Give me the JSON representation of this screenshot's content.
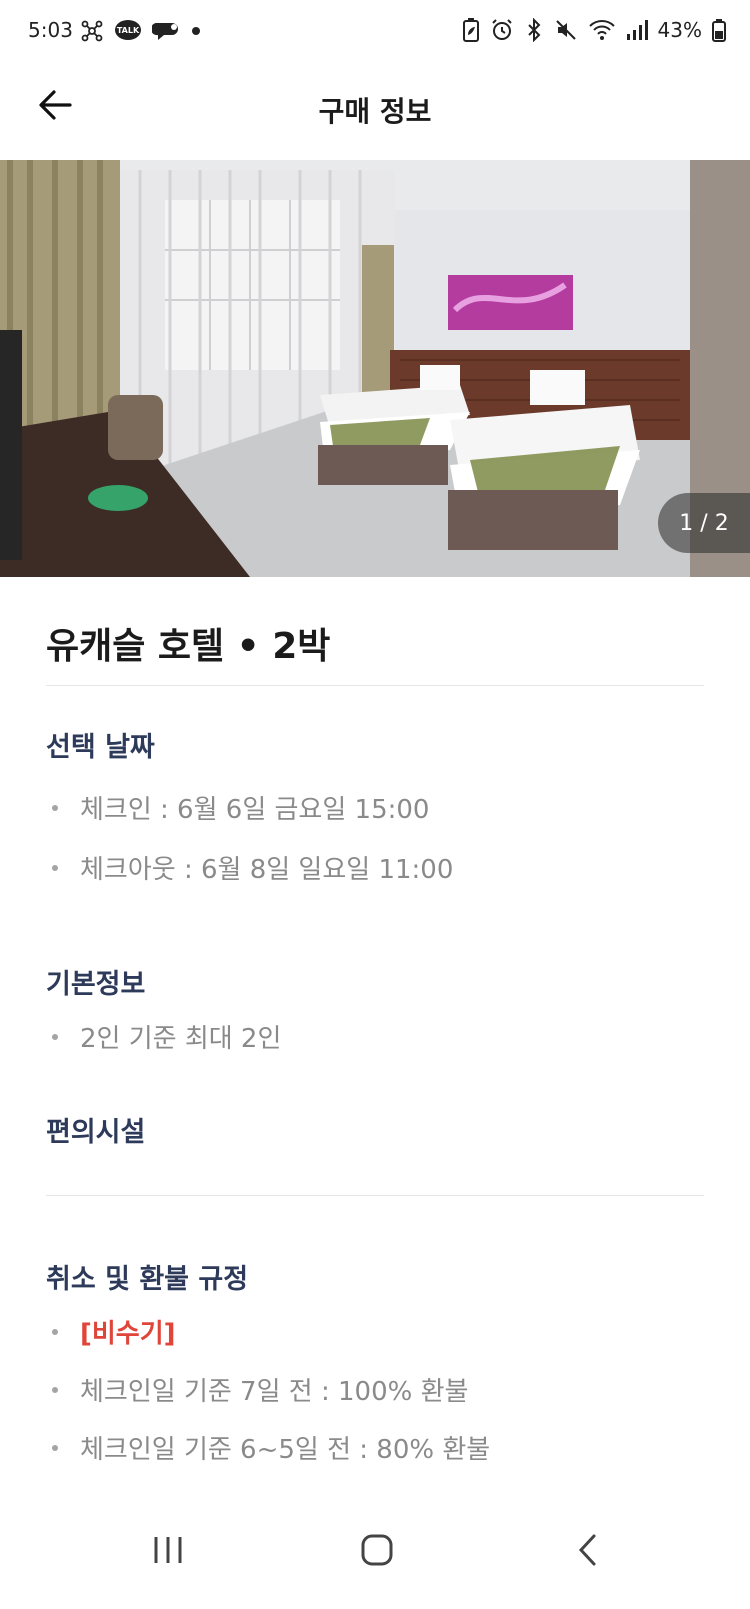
{
  "status_bar": {
    "time": "5:03",
    "battery": "43%",
    "left_icons": [
      "network-icon",
      "kakaotalk-icon",
      "chat-bubble-icon",
      "dot-icon"
    ],
    "right_icons": [
      "battery-saver-icon",
      "alarm-icon",
      "bluetooth-icon",
      "mute-icon",
      "wifi-icon",
      "signal-icon",
      "battery-icon"
    ]
  },
  "header": {
    "title": "구매 정보",
    "back_icon": "arrow-left-icon"
  },
  "hero": {
    "pager": "1 / 2"
  },
  "listing": {
    "title": "유캐슬 호텔 • 2박"
  },
  "sections": {
    "dates": {
      "title": "선택 날짜",
      "items": [
        "체크인 : 6월 6일 금요일 15:00",
        "체크아웃 : 6월 8일 일요일 11:00"
      ]
    },
    "basic": {
      "title": "기본정보",
      "items": [
        "2인 기준 최대 2인"
      ]
    },
    "amenities": {
      "title": "편의시설"
    },
    "refund": {
      "title": "취소 및 환불 규정",
      "season": "[비수기]",
      "items": [
        "체크인일 기준 7일 전 : 100% 환불",
        "체크인일 기준 6~5일 전 : 80% 환불"
      ]
    }
  },
  "nav": {
    "recent_icon": "recent-apps-icon",
    "home_icon": "home-icon",
    "back_icon": "back-chevron-icon"
  },
  "colors": {
    "section_title": "#2d3a5a",
    "body_text": "#8a8a8a",
    "accent_red": "#e0453a"
  }
}
